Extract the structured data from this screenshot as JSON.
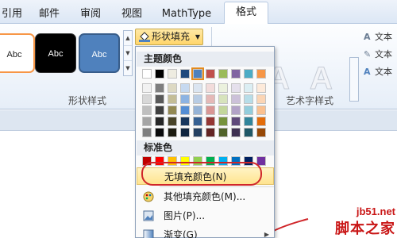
{
  "tabs": [
    "引用",
    "邮件",
    "审阅",
    "视图",
    "MathType",
    "格式"
  ],
  "shape_styles": {
    "samples": [
      "Abc",
      "Abc",
      "Abc"
    ],
    "group_label": "形状样式",
    "fill_button_label": "形状填充",
    "fill_button_arrow": "▼"
  },
  "wordart": {
    "samples": [
      "A",
      "A",
      "A"
    ],
    "group_label": "艺术字样式",
    "options": [
      "文本",
      "文本",
      "文本"
    ]
  },
  "fill_menu": {
    "theme_heading": "主题颜色",
    "theme_top_row": [
      "#ffffff",
      "#000000",
      "#eeece1",
      "#1f497d",
      "#4f81bd",
      "#c0504d",
      "#9bbb59",
      "#8064a2",
      "#4bacc6",
      "#f79646"
    ],
    "theme_shades": [
      [
        "#f2f2f2",
        "#7f7f7f",
        "#ddd9c3",
        "#c6d9f0",
        "#dbe5f1",
        "#f2dcdb",
        "#ebf1dd",
        "#e5e0ec",
        "#dbeef3",
        "#fdeada"
      ],
      [
        "#d8d8d8",
        "#595959",
        "#c4bd97",
        "#8db3e2",
        "#b8cce4",
        "#e5b9b7",
        "#d7e3bc",
        "#ccc1d9",
        "#b7dde8",
        "#fbd5b5"
      ],
      [
        "#bfbfbf",
        "#3f3f3f",
        "#938953",
        "#548dd4",
        "#95b3d7",
        "#d99694",
        "#c3d69b",
        "#b2a2c7",
        "#92cddc",
        "#fac08f"
      ],
      [
        "#a5a5a5",
        "#262626",
        "#494429",
        "#17365d",
        "#366092",
        "#953734",
        "#76923c",
        "#5f497a",
        "#31859b",
        "#e36c09"
      ],
      [
        "#7f7f7f",
        "#0c0c0c",
        "#1d1b10",
        "#0f243e",
        "#244061",
        "#632423",
        "#4f6128",
        "#3f3151",
        "#205867",
        "#974806"
      ]
    ],
    "selected_color": "#4f81bd",
    "standard_heading": "标准色",
    "standard_colors": [
      "#c00000",
      "#ff0000",
      "#ffc000",
      "#ffff00",
      "#92d050",
      "#00b050",
      "#00b0f0",
      "#0070c0",
      "#002060",
      "#7030a0"
    ],
    "items": [
      {
        "label": "无填充颜色(N)",
        "icon": "none"
      },
      {
        "label": "其他填充颜色(M)...",
        "icon": "palette-icon"
      },
      {
        "label": "图片(P)...",
        "icon": "picture-icon"
      },
      {
        "label": "渐变(G)",
        "icon": "gradient-icon"
      }
    ],
    "submenu_arrow": "▶"
  },
  "watermark": {
    "line1": "jb51.net",
    "line2": "脚本之家"
  }
}
